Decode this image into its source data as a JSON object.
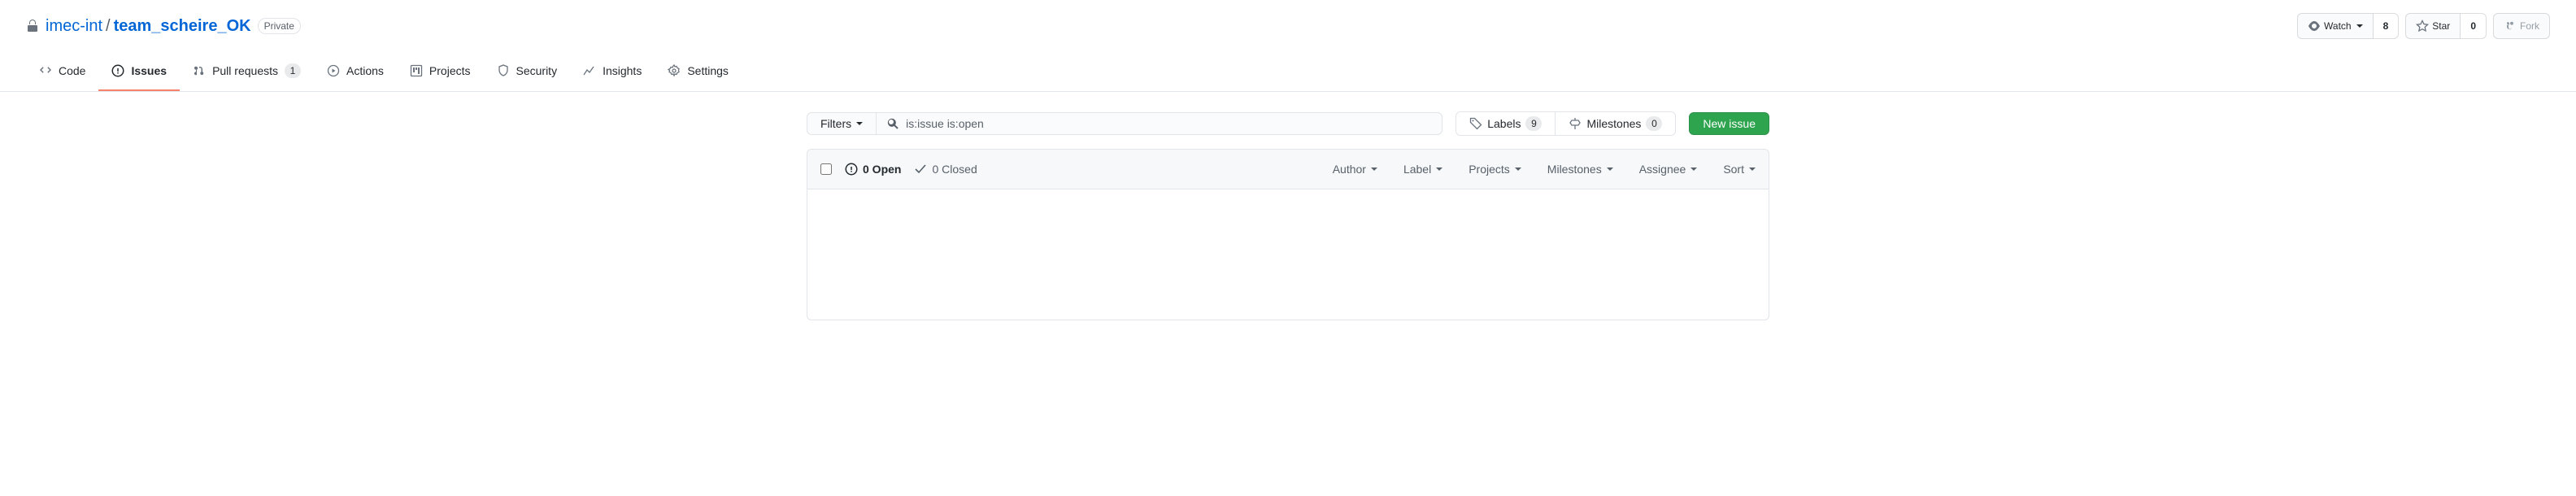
{
  "header": {
    "owner": "imec-int",
    "separator": "/",
    "repo": "team_scheire_OK",
    "visibility": "Private",
    "actions": {
      "watch": "Watch",
      "watch_count": "8",
      "star": "Star",
      "star_count": "0",
      "fork": "Fork"
    }
  },
  "tabs": {
    "code": "Code",
    "issues": "Issues",
    "pulls": "Pull requests",
    "pulls_count": "1",
    "actions": "Actions",
    "projects": "Projects",
    "security": "Security",
    "insights": "Insights",
    "settings": "Settings"
  },
  "filters": {
    "filters_label": "Filters",
    "search_value": "is:issue is:open",
    "labels": "Labels",
    "labels_count": "9",
    "milestones": "Milestones",
    "milestones_count": "0",
    "new_issue": "New issue"
  },
  "list_header": {
    "open": "0 Open",
    "closed": "0 Closed",
    "author": "Author",
    "label": "Label",
    "projects": "Projects",
    "milestones": "Milestones",
    "assignee": "Assignee",
    "sort": "Sort"
  }
}
